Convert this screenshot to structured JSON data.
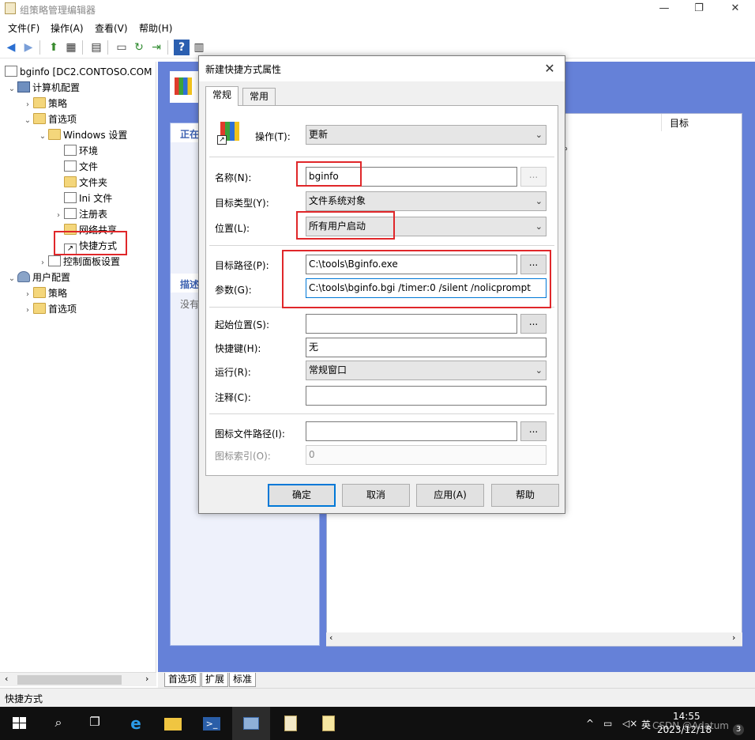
{
  "window": {
    "title": "组策略管理编辑器",
    "buttons": {
      "minimize": "—",
      "maximize": "❐",
      "close": "✕"
    }
  },
  "menu": [
    "文件(F)",
    "操作(A)",
    "查看(V)",
    "帮助(H)"
  ],
  "tree": {
    "root": "bginfo [DC2.CONTOSO.COM",
    "computer_config": "计算机配置",
    "policies": "策略",
    "preferences": "首选项",
    "windows_settings": "Windows 设置",
    "environment": "环境",
    "files": "文件",
    "folders": "文件夹",
    "ini_files": "Ini 文件",
    "registry": "注册表",
    "network_shares": "网络共享",
    "shortcuts": "快捷方式",
    "control_panel": "控制面板设置",
    "user_config": "用户配置",
    "user_policies": "策略",
    "user_preferences": "首选项"
  },
  "right_pane": {
    "strip_head_1": "正在",
    "strip_head_2": "描述",
    "strip_text_2": "没有",
    "col_target": "目标",
    "dot": "。"
  },
  "bottom_tabs": [
    "首选项",
    "扩展",
    "标准"
  ],
  "status": "快捷方式",
  "dialog": {
    "title": "新建快捷方式属性",
    "tabs": [
      "常规",
      "常用"
    ],
    "action_label": "操作(T):",
    "action_value": "更新",
    "name_label": "名称(N):",
    "name_value": "bginfo",
    "target_type_label": "目标类型(Y):",
    "target_type_value": "文件系统对象",
    "location_label": "位置(L):",
    "location_value": "所有用户启动",
    "target_path_label": "目标路径(P):",
    "target_path_value": "C:\\tools\\Bginfo.exe",
    "args_label": "参数(G):",
    "args_value": "C:\\tools\\bginfo.bgi /timer:0 /silent /nolicprompt",
    "start_in_label": "起始位置(S):",
    "start_in_value": "",
    "hotkey_label": "快捷键(H):",
    "hotkey_value": "无",
    "run_label": "运行(R):",
    "run_value": "常规窗口",
    "comment_label": "注释(C):",
    "comment_value": "",
    "icon_path_label": "图标文件路径(I):",
    "icon_path_value": "",
    "icon_index_label": "图标索引(O):",
    "icon_index_value": "0",
    "browse": "...",
    "buttons": {
      "ok": "确定",
      "cancel": "取消",
      "apply": "应用(A)",
      "help": "帮助"
    }
  },
  "taskbar": {
    "ime": "英",
    "time": "14:55",
    "date": "2023/12/18",
    "watermark": "CSDN @Adatum",
    "notification_count": "3"
  },
  "colors": {
    "accent": "#0078d7",
    "highlight": "#e0272a",
    "panel": "#6581d8"
  }
}
